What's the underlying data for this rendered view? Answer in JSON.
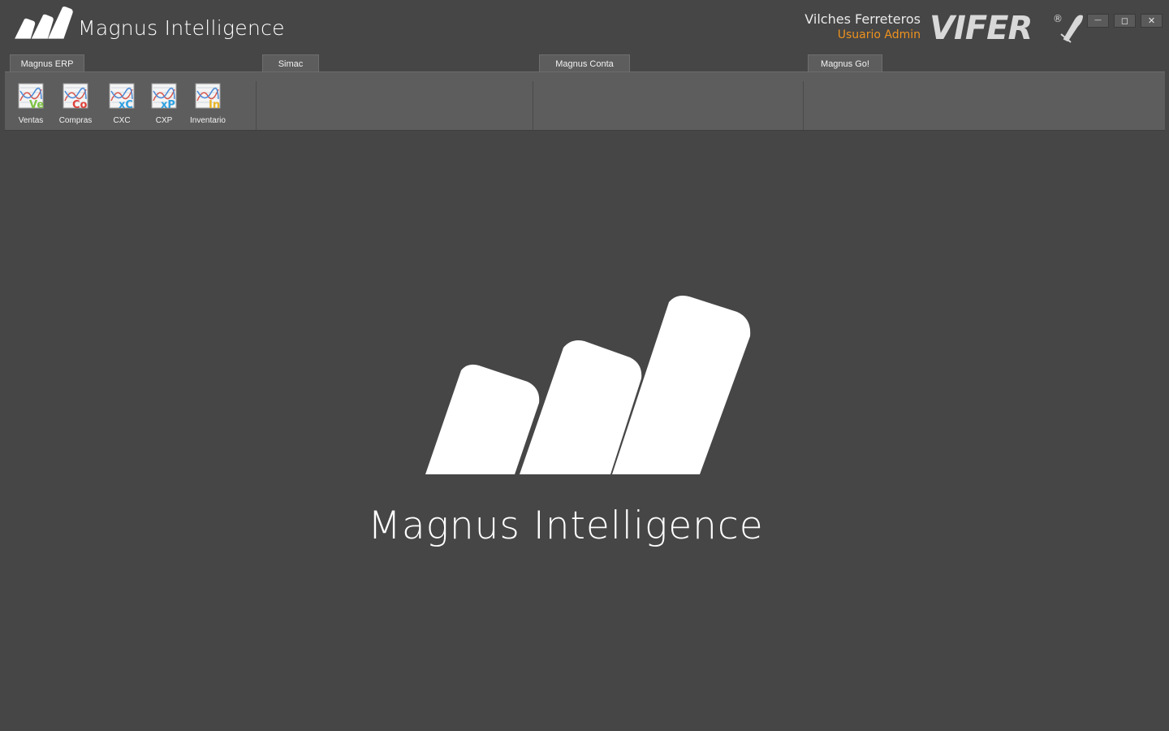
{
  "header": {
    "app_title": "Magnus Intelligence",
    "company_name": "Vilches Ferreteros",
    "user_name": "Usuario Admin",
    "brand_logo_text": "VIFER",
    "brand_registered_mark": "®",
    "window_controls": {
      "minimize_glyph": "—",
      "maximize_glyph": "◻",
      "close_glyph": "✕"
    }
  },
  "tabs": [
    {
      "label": "Magnus ERP"
    },
    {
      "label": "Simac"
    },
    {
      "label": "Magnus Conta"
    },
    {
      "label": "Magnus Go!"
    }
  ],
  "ribbon": {
    "erp_buttons": [
      {
        "label": "Ventas",
        "icon": "ventas-chart-icon",
        "badge": "Ve",
        "badge_color": "#7dc142"
      },
      {
        "label": "Compras",
        "icon": "compras-chart-icon",
        "badge": "Co",
        "badge_color": "#e0413b"
      },
      {
        "label": "CXC",
        "icon": "cxc-chart-icon",
        "badge": "xC",
        "badge_color": "#2e9fe0"
      },
      {
        "label": "CXP",
        "icon": "cxp-chart-icon",
        "badge": "xP",
        "badge_color": "#2e9fe0"
      },
      {
        "label": "Inventario",
        "icon": "inventario-chart-icon",
        "badge": "In",
        "badge_color": "#e8b526"
      }
    ]
  },
  "splash": {
    "title": "Magnus Intelligence",
    "logo_icon": "magnus-bars-logo"
  },
  "colors": {
    "background": "#464646",
    "panel": "#5d5d5d",
    "accent_user": "#f0921e",
    "text": "#ffffff"
  }
}
